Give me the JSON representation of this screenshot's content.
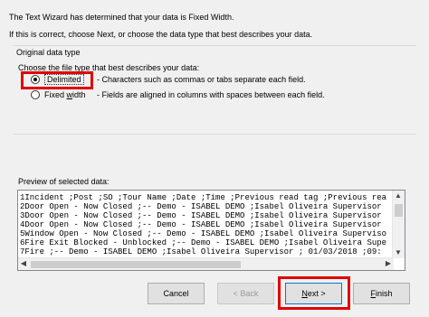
{
  "header": {
    "line1": "The Text Wizard has determined that your data is Fixed Width.",
    "line2": "If this is correct, choose Next, or choose the data type that best describes your data."
  },
  "data_type_group": {
    "label": "Original data type",
    "prompt": "Choose the file type that best describes your data:",
    "options": [
      {
        "label": "Delimited",
        "description": "- Characters such as commas or tabs separate each field.",
        "selected": true
      },
      {
        "label_pre": "Fixed ",
        "label_mnemonic": "w",
        "label_post": "idth",
        "description": "- Fields are aligned in columns with spaces between each field.",
        "selected": false
      }
    ]
  },
  "preview": {
    "label": "Preview of selected data:",
    "rows": [
      {
        "num": "1",
        "text": "Incident ;Post ;SO ;Tour Name ;Date ;Time ;Previous read tag ;Previous rea"
      },
      {
        "num": "2",
        "text": "Door Open - Now Closed ;-- Demo - ISABEL DEMO ;Isabel Oliveira Supervisor"
      },
      {
        "num": "3",
        "text": "Door Open - Now Closed ;-- Demo - ISABEL DEMO ;Isabel Oliveira Supervisor"
      },
      {
        "num": "4",
        "text": "Door Open - Now Closed ;-- Demo - ISABEL DEMO ;Isabel Oliveira Supervisor"
      },
      {
        "num": "5",
        "text": "Window Open - Now Closed ;-- Demo - ISABEL DEMO ;Isabel Oliveira Superviso"
      },
      {
        "num": "6",
        "text": "Fire Exit Blocked - Unblocked ;-- Demo - ISABEL DEMO ;Isabel Oliveira Supe"
      },
      {
        "num": "7",
        "text": "Fire ;-- Demo - ISABEL DEMO ;Isabel Oliveira Supervisor ; 01/03/2018 ;09:"
      }
    ]
  },
  "buttons": {
    "cancel": "Cancel",
    "back": "< Back",
    "next_mnemonic": "N",
    "next_rest": "ext >",
    "finish_mnemonic": "F",
    "finish_rest": "inish"
  },
  "colors": {
    "highlight": "#e00000",
    "dialog_bg": "#f0f0f0"
  }
}
